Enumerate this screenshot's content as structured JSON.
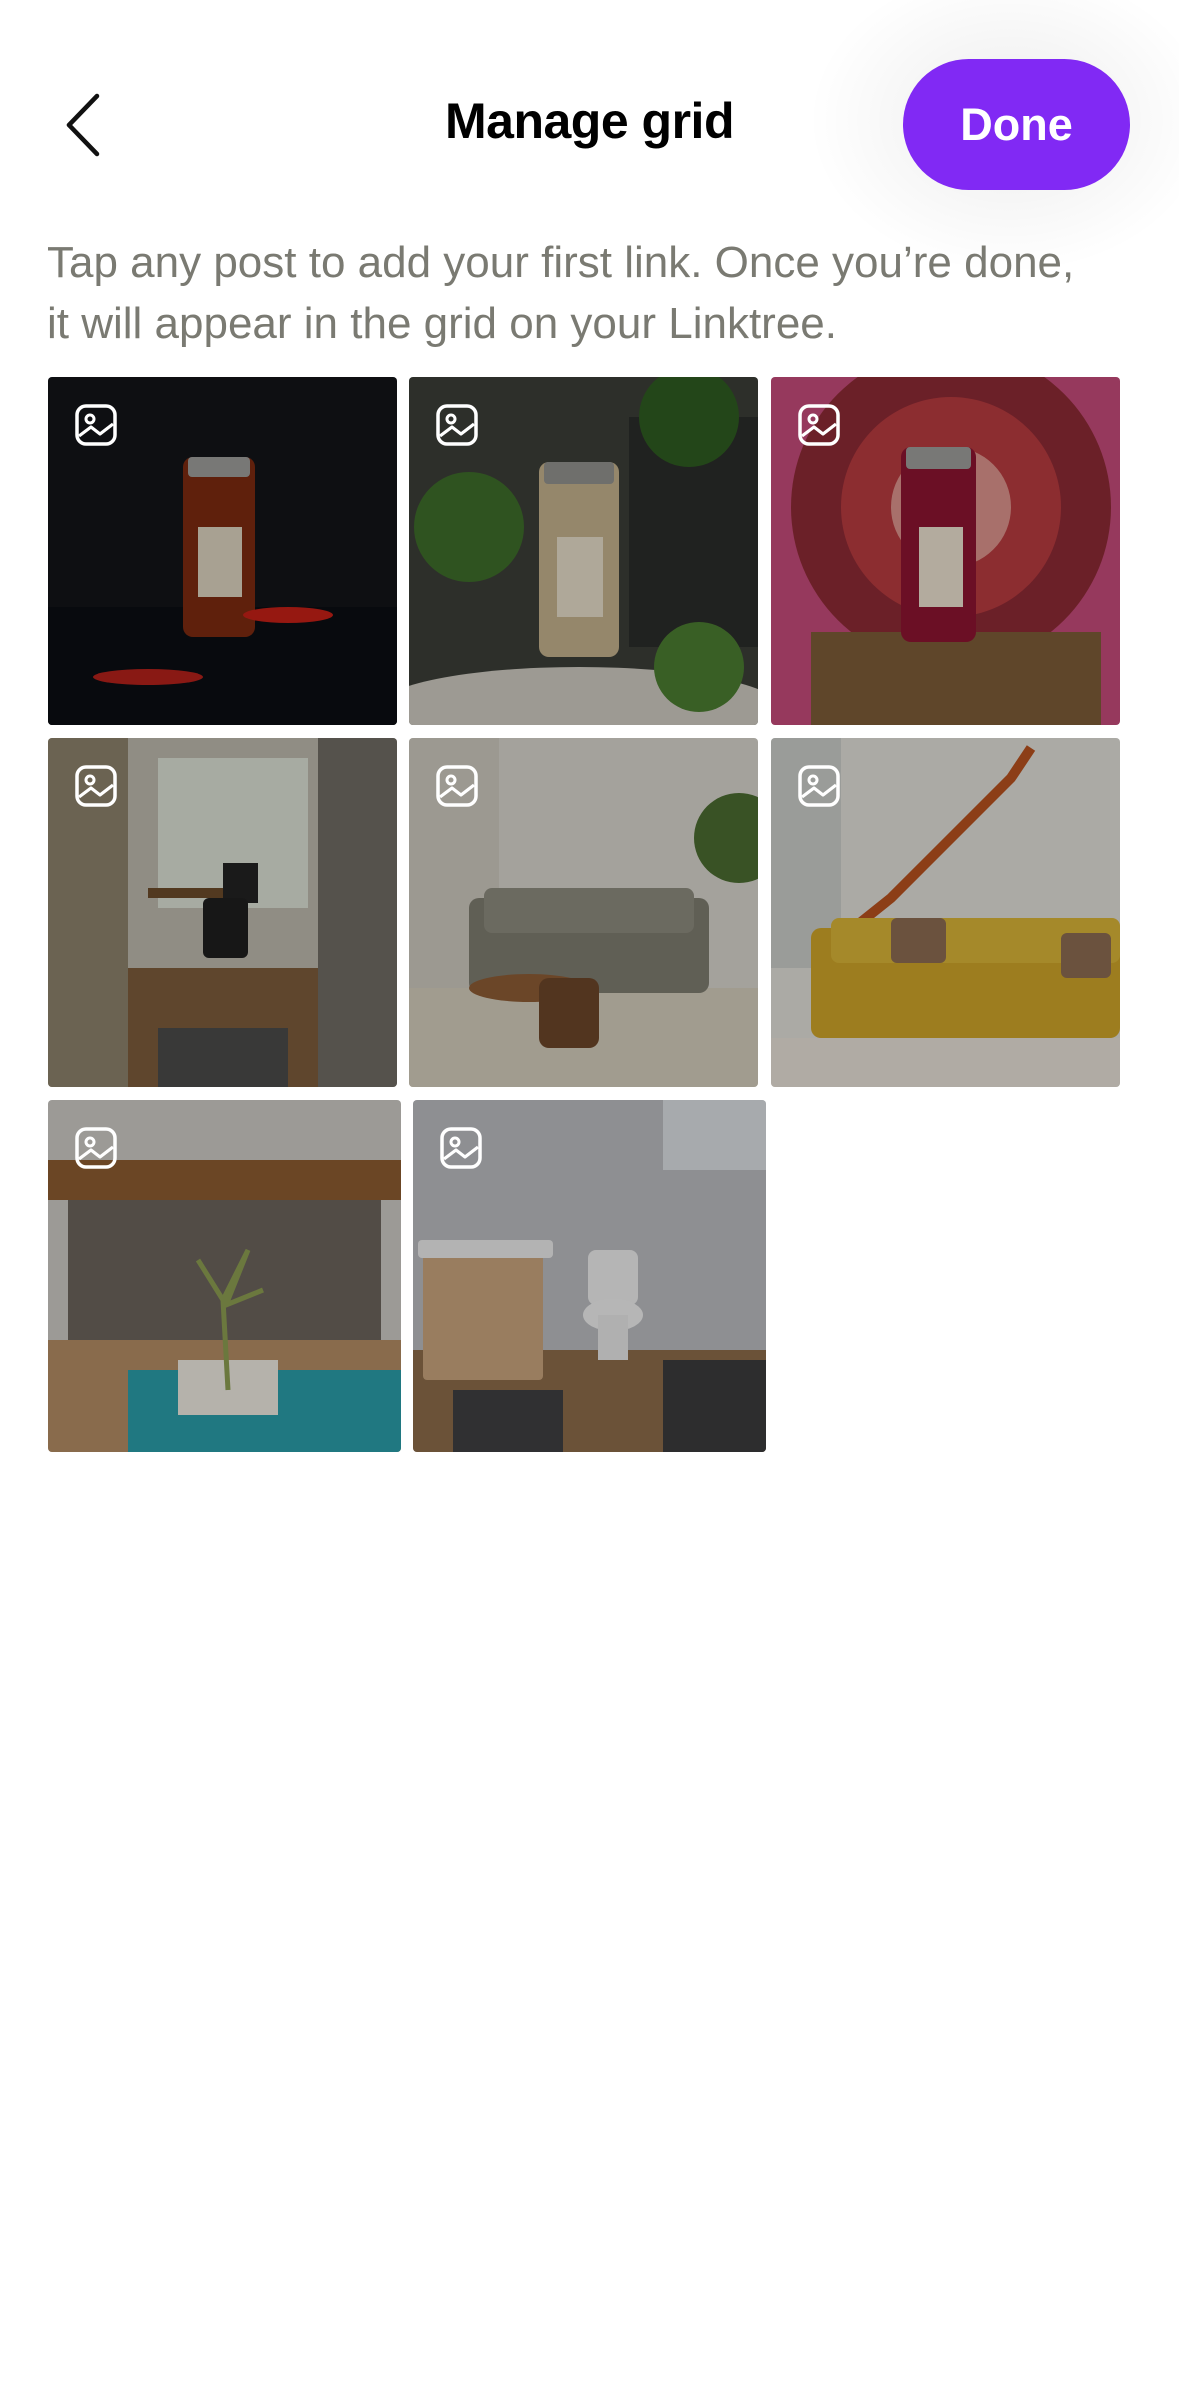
{
  "header": {
    "title": "Manage grid",
    "done_label": "Done",
    "back_icon": "chevron-left-icon"
  },
  "subtitle": {
    "line1": "Tap any post to add your first link. Once you’re done,",
    "line2": "it will appear in the grid on your Linktree."
  },
  "colors": {
    "accent": "#8129f4",
    "subtitle_text": "#7a7a72",
    "title_text": "#000000"
  },
  "grid": {
    "tile_icon": "image-icon",
    "posts": [
      {
        "subject": "spice jar with red chili peppers on dark background"
      },
      {
        "subject": "spice jar among green plants"
      },
      {
        "subject": "red spice jar in front of red decorative plate"
      },
      {
        "subject": "home office with desk and chair"
      },
      {
        "subject": "living room with grey sofa and wooden chairs"
      },
      {
        "subject": "living room with yellow sofa and staircase"
      },
      {
        "subject": "courtyard with pool and palm tree"
      },
      {
        "subject": "bathroom with wooden vanity and toilet"
      }
    ]
  }
}
